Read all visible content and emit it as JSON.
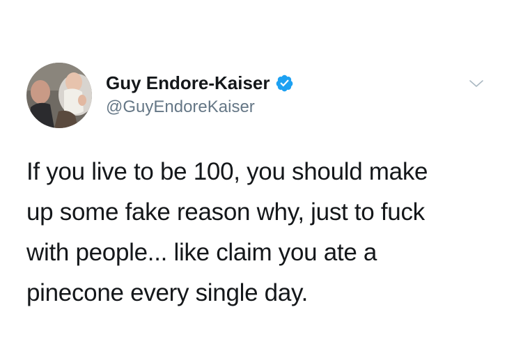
{
  "author": {
    "display_name": "Guy Endore-Kaiser",
    "handle": "@GuyEndoreKaiser",
    "verified": true
  },
  "tweet": {
    "lines": [
      "If you live to be 100, you should make",
      "up some fake reason why, just to fuck",
      "with people... like claim you ate a",
      "pinecone every single day."
    ]
  },
  "icons": {
    "avatar": "profile-photo",
    "verified": "verified-badge-icon",
    "menu": "chevron-down-icon"
  },
  "colors": {
    "text": "#14171a",
    "handle": "#657786",
    "verified_blue": "#1da1f2",
    "chevron": "#aab8c2",
    "background": "#ffffff"
  }
}
